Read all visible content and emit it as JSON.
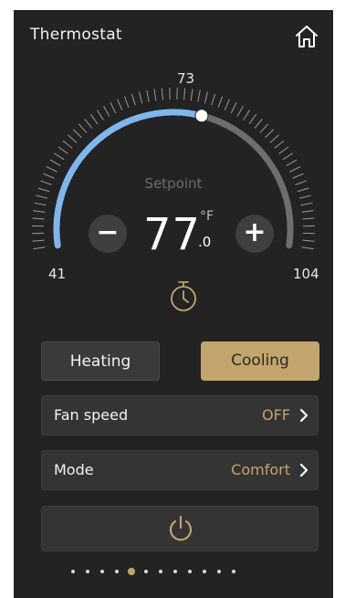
{
  "header": {
    "title": "Thermostat",
    "home_icon": "home-icon"
  },
  "dial": {
    "min_label": "41",
    "max_label": "104",
    "top_label": "73",
    "setpoint_label": "Setpoint",
    "min": 41,
    "max": 104,
    "value": 77,
    "colors": {
      "active": "#7fb6ec",
      "inactive": "#6e6e6e",
      "knob": "#ffffff"
    }
  },
  "temperature": {
    "whole": "77",
    "unit": "°F",
    "decimal": ".0"
  },
  "controls": {
    "minus": "−",
    "plus": "+"
  },
  "modes": {
    "heating": "Heating",
    "cooling": "Cooling",
    "selected": "Cooling"
  },
  "fan": {
    "label": "Fan speed",
    "value": "OFF"
  },
  "mode_row": {
    "label": "Mode",
    "value": "Comfort"
  },
  "power": {
    "icon": "power-icon"
  },
  "pager": {
    "count": 12,
    "active_index": 4
  },
  "colors": {
    "accent": "#c2a56c",
    "panel": "#232323",
    "row": "#343434"
  }
}
